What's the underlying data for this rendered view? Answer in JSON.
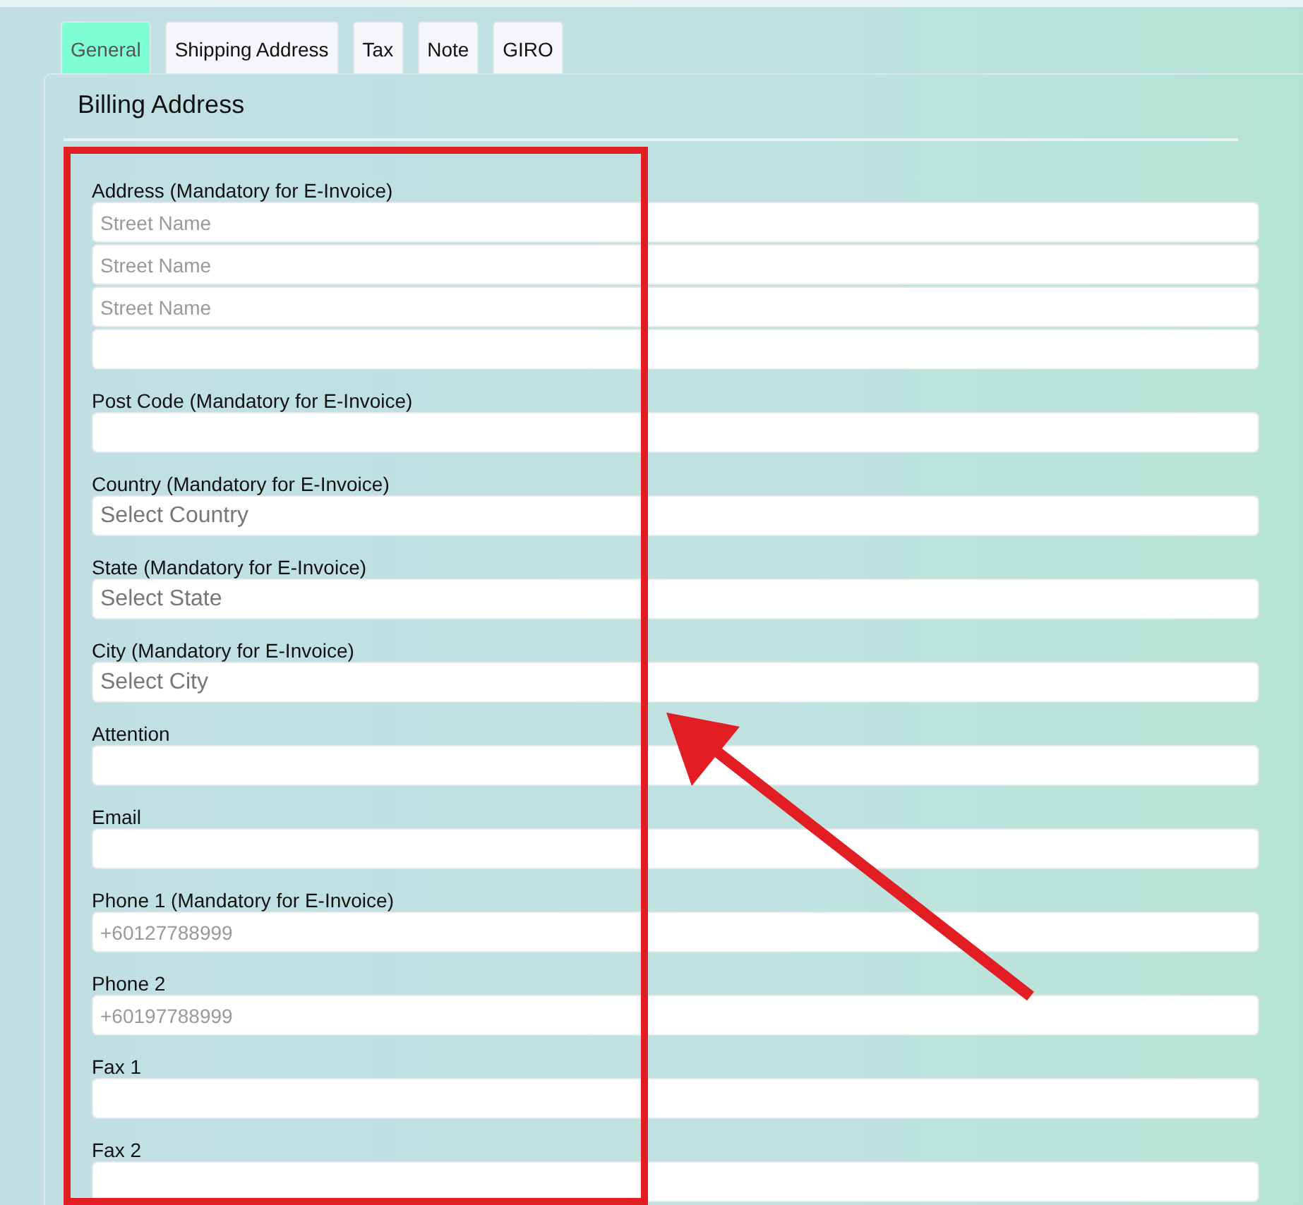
{
  "tabs": [
    {
      "label": "General",
      "selected": true
    },
    {
      "label": "Shipping Address",
      "selected": false
    },
    {
      "label": "Tax",
      "selected": false
    },
    {
      "label": "Note",
      "selected": false
    },
    {
      "label": "GIRO",
      "selected": false
    }
  ],
  "panel": {
    "title": "Billing Address",
    "fields": [
      {
        "label": "Address (Mandatory for E-Invoice)",
        "inputs": [
          {
            "kind": "text",
            "placeholder": "Street Name"
          },
          {
            "kind": "text",
            "placeholder": "Street Name"
          },
          {
            "kind": "text",
            "placeholder": "Street Name"
          },
          {
            "kind": "text"
          }
        ]
      },
      {
        "label": "Post Code (Mandatory for E-Invoice)",
        "inputs": [
          {
            "kind": "text"
          }
        ]
      },
      {
        "label": "Country (Mandatory for E-Invoice)",
        "inputs": [
          {
            "kind": "select",
            "placeholder": "Select Country"
          }
        ]
      },
      {
        "label": "State (Mandatory for E-Invoice)",
        "inputs": [
          {
            "kind": "select",
            "placeholder": "Select State"
          }
        ]
      },
      {
        "label": "City (Mandatory for E-Invoice)",
        "inputs": [
          {
            "kind": "select",
            "placeholder": "Select City"
          }
        ]
      },
      {
        "label": "Attention",
        "inputs": [
          {
            "kind": "text"
          }
        ]
      },
      {
        "label": "Email",
        "inputs": [
          {
            "kind": "text"
          }
        ]
      },
      {
        "label": "Phone 1 (Mandatory for E-Invoice)",
        "inputs": [
          {
            "kind": "text",
            "placeholder": "+60127788999"
          }
        ]
      },
      {
        "label": "Phone 2",
        "inputs": [
          {
            "kind": "text",
            "placeholder": "+60197788999"
          }
        ]
      },
      {
        "label": "Fax 1",
        "inputs": [
          {
            "kind": "text"
          }
        ]
      },
      {
        "label": "Fax 2",
        "inputs": [
          {
            "kind": "text"
          }
        ]
      }
    ]
  },
  "annotations": {
    "highlight_box": true,
    "arrow": true
  }
}
